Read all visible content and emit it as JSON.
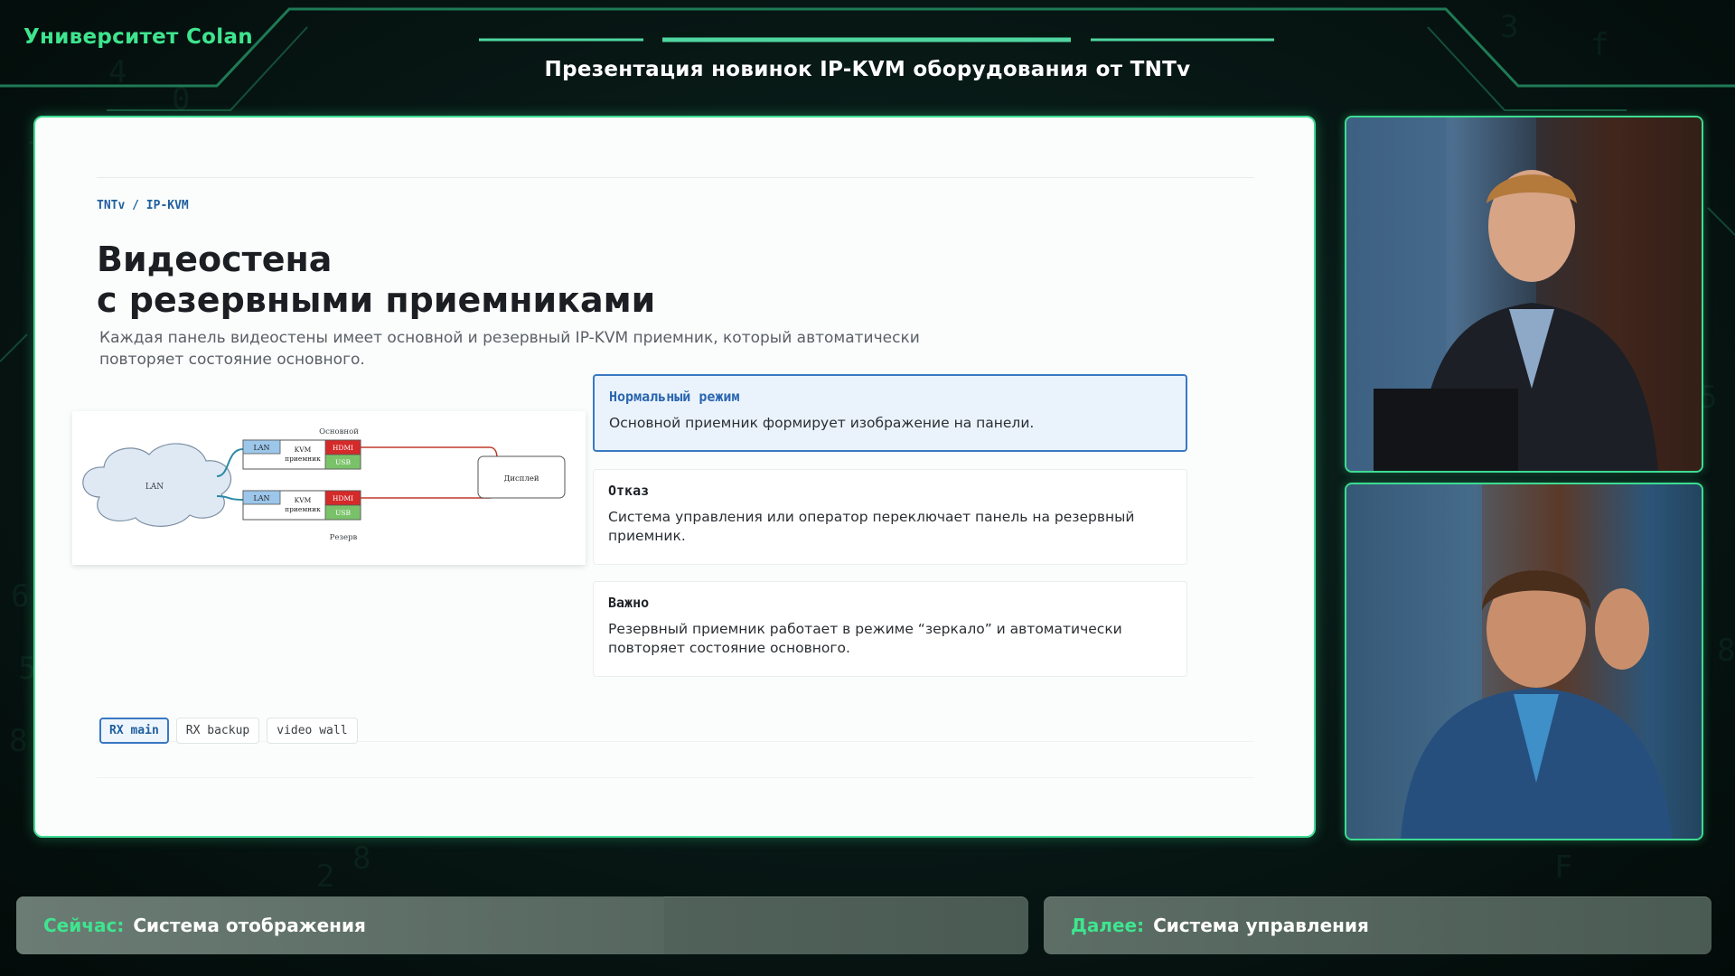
{
  "header": {
    "brand": "Университет Colan",
    "title": "Презентация новинок IP-KVM оборудования от TNTv"
  },
  "slide": {
    "breadcrumb": "TNTv / IP-KVM",
    "heading_line1": "Видеостена",
    "heading_line2": "с резервными приемниками",
    "lead": "Каждая панель видеостены имеет основной и резервный IP-KVM приемник, который автоматически повторяет состояние основного.",
    "diagram": {
      "cloud": "LAN",
      "top_caption": "Основной",
      "bottom_caption": "Резерв",
      "lan_port": "LAN",
      "kvm_line1": "KVM",
      "kvm_line2": "приемник",
      "hdmi": "HDMI",
      "usb": "USB",
      "display": "Дисплей"
    },
    "cards": [
      {
        "title": "Нормальный режим",
        "body": "Основной приемник формирует изображение на панели.",
        "active": true
      },
      {
        "title": "Отказ",
        "body": "Система управления или оператор переключает панель на резервный приемник.",
        "active": false
      },
      {
        "title": "Важно",
        "body": "Резервный приемник работает в режиме “зеркало” и автоматически повторяет состояние основного.",
        "active": false
      }
    ],
    "chips": [
      {
        "label": "RX main",
        "active": true
      },
      {
        "label": "RX backup",
        "active": false
      },
      {
        "label": "video wall",
        "active": false
      }
    ]
  },
  "footer": {
    "now_label": "Сейчас:",
    "now_value": "Система отображения",
    "next_label": "Далее:",
    "next_value": "Система управления",
    "progress": 0.64
  },
  "colors": {
    "accent": "#3ee58e",
    "frame": "#3ddc92",
    "active_blue": "#3a78c2",
    "hdmi": "#d42a2a",
    "usb": "#7ac26a",
    "lan_port": "#9cc6ea"
  }
}
